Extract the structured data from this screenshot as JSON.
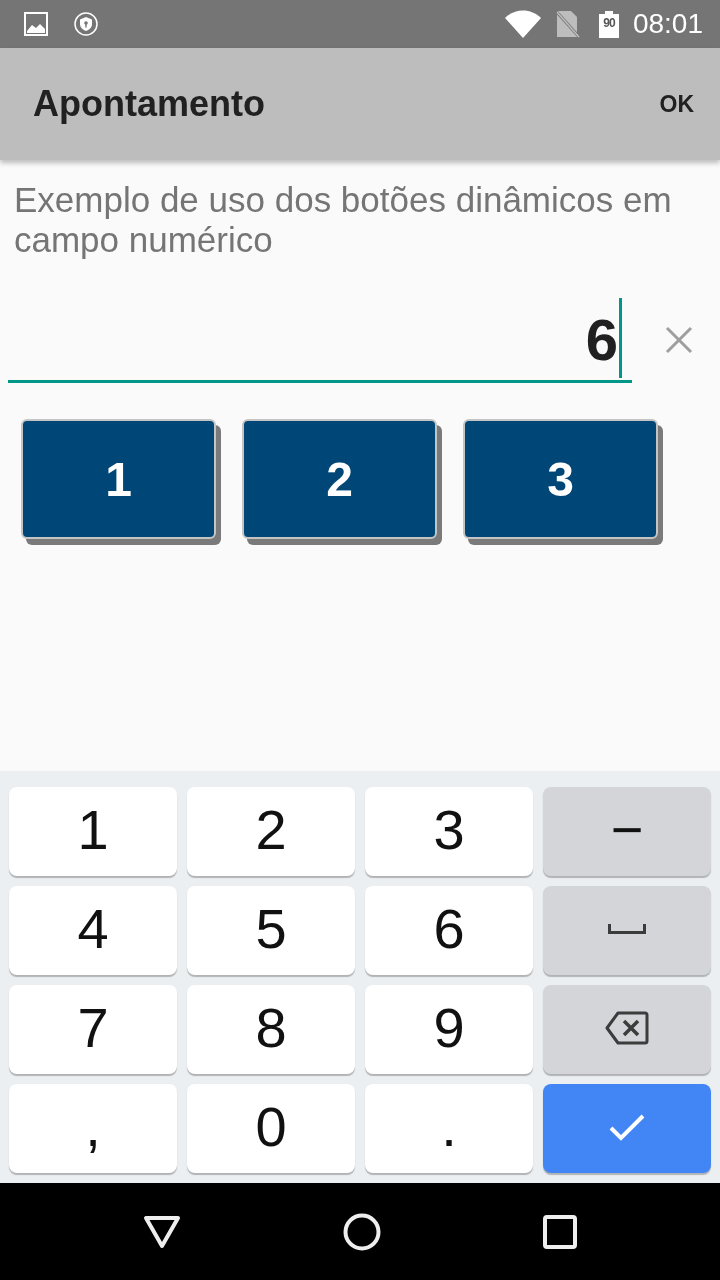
{
  "status_bar": {
    "battery": "90",
    "time": "08:01"
  },
  "app_bar": {
    "title": "Apontamento",
    "action": "OK"
  },
  "description": "Exemplo de uso dos botões dinâmicos em campo numérico",
  "number_field": {
    "value": "6",
    "focused": true
  },
  "quick_buttons": [
    {
      "label": "1"
    },
    {
      "label": "2"
    },
    {
      "label": "3"
    }
  ],
  "keyboard": {
    "keys": [
      {
        "kind": "digit",
        "label": "1"
      },
      {
        "kind": "digit",
        "label": "2"
      },
      {
        "kind": "digit",
        "label": "3"
      },
      {
        "kind": "sign",
        "label": "−"
      },
      {
        "kind": "digit",
        "label": "4"
      },
      {
        "kind": "digit",
        "label": "5"
      },
      {
        "kind": "digit",
        "label": "6"
      },
      {
        "kind": "space"
      },
      {
        "kind": "digit",
        "label": "7"
      },
      {
        "kind": "digit",
        "label": "8"
      },
      {
        "kind": "digit",
        "label": "9"
      },
      {
        "kind": "backspace"
      },
      {
        "kind": "digit",
        "label": ","
      },
      {
        "kind": "digit",
        "label": "0"
      },
      {
        "kind": "digit",
        "label": "."
      },
      {
        "kind": "enter"
      }
    ]
  }
}
